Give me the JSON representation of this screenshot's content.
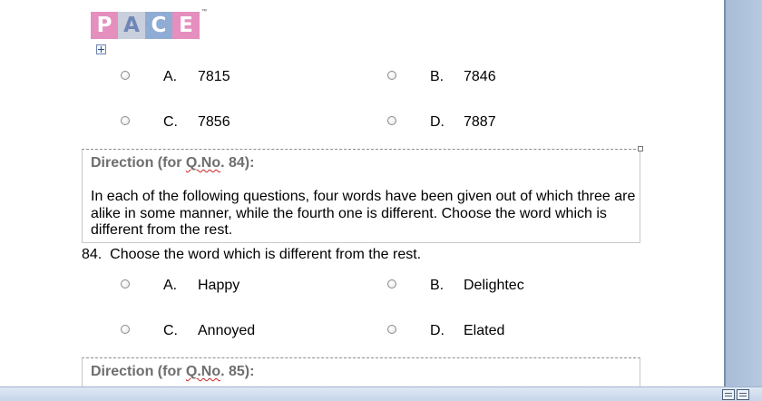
{
  "logo": {
    "letters": [
      "P",
      "A",
      "C",
      "E"
    ],
    "letter_colors": [
      "#e58fbf",
      "#a4b6d8",
      "#8fadd4",
      "#e58fbf"
    ],
    "trademark": "™"
  },
  "q83_options": [
    {
      "letter": "A.",
      "value": "7815"
    },
    {
      "letter": "B.",
      "value": "7846"
    },
    {
      "letter": "C.",
      "value": "7856"
    },
    {
      "letter": "D.",
      "value": "7887"
    }
  ],
  "direction_84": {
    "head_prefix": "Direction (for ",
    "head_qno": "Q.No",
    "head_suffix": ". 84):",
    "body": "In each of the following questions, four words have been given out of which three are alike in some manner, while the fourth one is different. Choose the word which is different from the rest."
  },
  "question_84": {
    "text": "84.  Choose the word which is different from the rest.",
    "options": [
      {
        "letter": "A.",
        "value": "Happy"
      },
      {
        "letter": "B.",
        "value": "Delightec"
      },
      {
        "letter": "C.",
        "value": "Annoyed"
      },
      {
        "letter": "D.",
        "value": "Elated"
      }
    ]
  },
  "direction_85": {
    "head_prefix": "Direction (for ",
    "head_qno": "Q.No",
    "head_suffix": ". 85):"
  },
  "colors": {
    "direction_heading": "#6e6e6e",
    "spellcheck": "#cc2222",
    "window_chrome": "#b7c9e0"
  }
}
